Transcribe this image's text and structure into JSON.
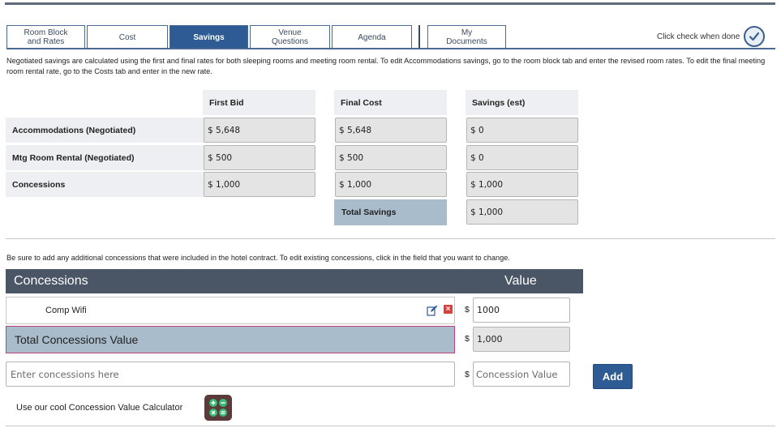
{
  "tabs": [
    {
      "label_line1": "Room Block",
      "label_line2": "and Rates"
    },
    {
      "label_line1": "Cost",
      "label_line2": ""
    },
    {
      "label_line1": "Savings",
      "label_line2": ""
    },
    {
      "label_line1": "Venue",
      "label_line2": "Questions"
    },
    {
      "label_line1": "Agenda",
      "label_line2": ""
    },
    {
      "label_line1": "My",
      "label_line2": "Documents"
    }
  ],
  "done": {
    "label": "Click check when done"
  },
  "intro_text": "Negotiated savings are calculated using the first and final rates for both sleeping rooms and meeting room rental. To edit Accommodations savings, go to the room block tab and enter the revised room rates. To edit the final meeting room rental rate, go to the Costs tab and enter in the new rate.",
  "savings_table": {
    "columns": [
      "First Bid",
      "Final Cost",
      "Savings (est)"
    ],
    "rows": [
      {
        "label": "Accommodations (Negotiated)",
        "first_bid": "$ 5,648",
        "final_cost": "$ 5,648",
        "savings": "$ 0"
      },
      {
        "label": "Mtg Room Rental (Negotiated)",
        "first_bid": "$ 500",
        "final_cost": "$ 500",
        "savings": "$ 0"
      },
      {
        "label": "Concessions",
        "first_bid": "$ 1,000",
        "final_cost": "$ 1,000",
        "savings": "$ 1,000"
      }
    ],
    "total_label": "Total Savings",
    "total_value": "$ 1,000"
  },
  "concessions_note": "Be sure to add any additional concessions that were included in the hotel contract. To edit existing concessions, click in the field that you want to change.",
  "concessions": {
    "header_left": "Concessions",
    "header_right": "Value",
    "items": [
      {
        "name": "Comp Wifi",
        "currency": "$",
        "value": "1000"
      }
    ],
    "total_label": "Total Concessions Value",
    "total_currency": "$",
    "total_value": "1,000",
    "enter_placeholder": "Enter concessions here",
    "value_currency": "$",
    "value_placeholder": "Concession Value",
    "add_label": "Add"
  },
  "calculator": {
    "label": "Use our cool Concession Value Calculator"
  }
}
